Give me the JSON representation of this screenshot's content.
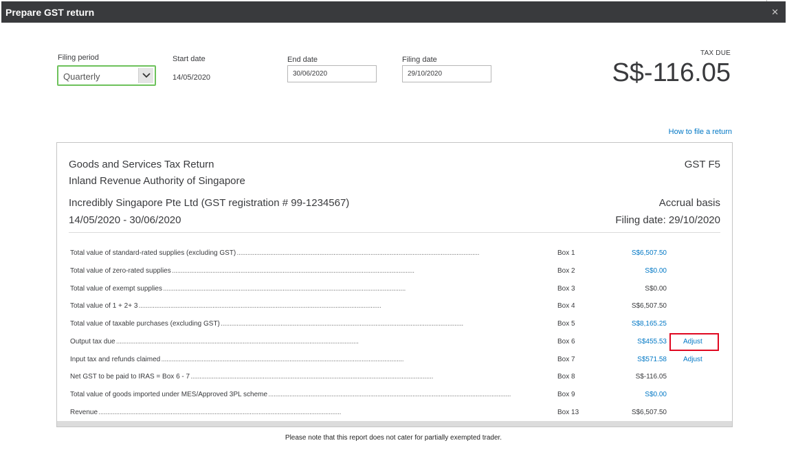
{
  "dialog": {
    "title": "Prepare GST return",
    "close_icon": "close-icon"
  },
  "filing": {
    "period_label": "Filing period",
    "period_value": "Quarterly",
    "start_label": "Start date",
    "start_value": "14/05/2020",
    "end_label": "End date",
    "end_value": "30/06/2020",
    "filing_label": "Filing date",
    "filing_value": "29/10/2020"
  },
  "tax_due": {
    "label": "TAX DUE",
    "value": "S$-116.05"
  },
  "how_to_link": "How to file a return",
  "report": {
    "title": "Goods and Services Tax Return",
    "authority": "Inland Revenue Authority of Singapore",
    "form": "GST F5",
    "company": "Incredibly Singapore Pte Ltd (GST registration # 99-1234567)",
    "period": "14/05/2020 - 30/06/2020",
    "basis": "Accrual basis",
    "filing_date": "Filing date: 29/10/2020",
    "rows": [
      {
        "desc": "Total value of standard-rated supplies (excluding GST)",
        "box": "Box 1",
        "amount": "S$6,507.50",
        "link": true,
        "adjust": ""
      },
      {
        "desc": "Total value of zero-rated supplies",
        "box": "Box 2",
        "amount": "S$0.00",
        "link": true,
        "adjust": ""
      },
      {
        "desc": "Total value of exempt supplies",
        "box": "Box 3",
        "amount": "S$0.00",
        "link": false,
        "adjust": ""
      },
      {
        "desc": "Total value of 1 + 2+ 3",
        "box": "Box 4",
        "amount": "S$6,507.50",
        "link": false,
        "adjust": ""
      },
      {
        "desc": "Total value of taxable purchases (excluding GST)",
        "box": "Box 5",
        "amount": "S$8,165.25",
        "link": true,
        "adjust": ""
      },
      {
        "desc": "Output tax due",
        "box": "Box 6",
        "amount": "S$455.53",
        "link": true,
        "adjust": "Adjust"
      },
      {
        "desc": "Input tax and refunds claimed",
        "box": "Box 7",
        "amount": "S$571.58",
        "link": true,
        "adjust": "Adjust"
      },
      {
        "desc": "Net GST to be paid to IRAS = Box 6 - 7",
        "box": "Box 8",
        "amount": "S$-116.05",
        "link": false,
        "adjust": ""
      },
      {
        "desc": "Total value of goods imported under MES/Approved 3PL scheme",
        "box": "Box 9",
        "amount": "S$0.00",
        "link": true,
        "adjust": ""
      },
      {
        "desc": "Revenue",
        "box": "Box 13",
        "amount": "S$6,507.50",
        "link": false,
        "adjust": ""
      }
    ]
  },
  "footer_note": "Please note that this report does not cater for partially exempted trader.",
  "colors": {
    "title_bar": "#393a3d",
    "link": "#0077c5",
    "focus_green": "#6cc15a",
    "highlight_red": "#e0061f"
  }
}
